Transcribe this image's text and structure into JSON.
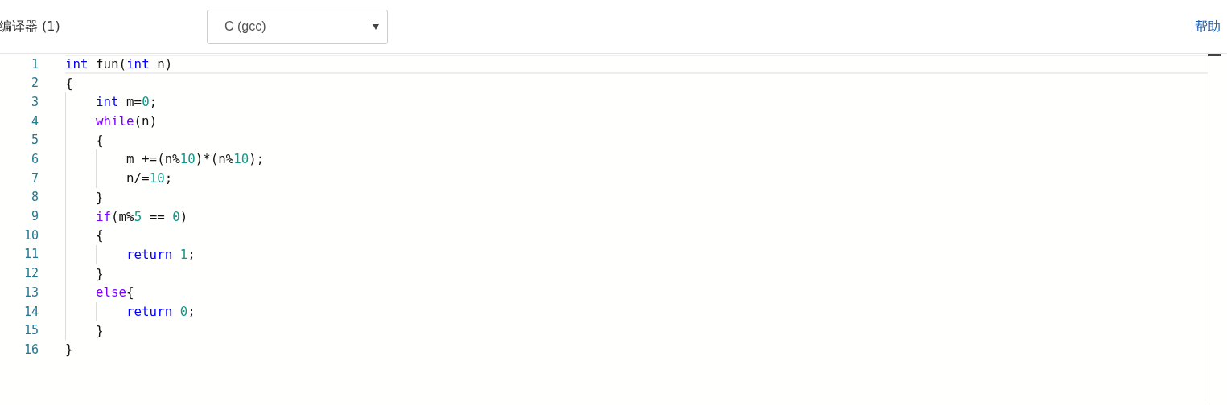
{
  "toolbar": {
    "compiler_label": "编译器 (1)",
    "language_select": {
      "value": "C (gcc)"
    },
    "help_link": "帮助"
  },
  "editor": {
    "lines": [
      {
        "number": "1",
        "current": true,
        "tokens": [
          {
            "kind": "keyword",
            "text": "int"
          },
          {
            "kind": "plain",
            "text": " fun("
          },
          {
            "kind": "keyword",
            "text": "int"
          },
          {
            "kind": "plain",
            "text": " n)"
          }
        ]
      },
      {
        "number": "2",
        "current": false,
        "tokens": [
          {
            "kind": "plain",
            "text": "{"
          }
        ]
      },
      {
        "number": "3",
        "current": false,
        "tokens": [
          {
            "kind": "keyword",
            "text": "    int"
          },
          {
            "kind": "plain",
            "text": " m="
          },
          {
            "kind": "number",
            "text": "0"
          },
          {
            "kind": "plain",
            "text": ";"
          }
        ]
      },
      {
        "number": "4",
        "current": false,
        "tokens": [
          {
            "kind": "control",
            "text": "    while"
          },
          {
            "kind": "plain",
            "text": "(n)"
          }
        ]
      },
      {
        "number": "5",
        "current": false,
        "tokens": [
          {
            "kind": "plain",
            "text": "    {"
          }
        ]
      },
      {
        "number": "6",
        "current": false,
        "tokens": [
          {
            "kind": "plain",
            "text": "        m +=(n%"
          },
          {
            "kind": "number",
            "text": "10"
          },
          {
            "kind": "plain",
            "text": ")*(n%"
          },
          {
            "kind": "number",
            "text": "10"
          },
          {
            "kind": "plain",
            "text": ");"
          }
        ]
      },
      {
        "number": "7",
        "current": false,
        "tokens": [
          {
            "kind": "plain",
            "text": "        n/="
          },
          {
            "kind": "number",
            "text": "10"
          },
          {
            "kind": "plain",
            "text": ";"
          }
        ]
      },
      {
        "number": "8",
        "current": false,
        "tokens": [
          {
            "kind": "plain",
            "text": "    }"
          }
        ]
      },
      {
        "number": "9",
        "current": false,
        "tokens": [
          {
            "kind": "control",
            "text": "    if"
          },
          {
            "kind": "plain",
            "text": "(m%"
          },
          {
            "kind": "number",
            "text": "5"
          },
          {
            "kind": "plain",
            "text": " == "
          },
          {
            "kind": "number",
            "text": "0"
          },
          {
            "kind": "plain",
            "text": ")"
          }
        ]
      },
      {
        "number": "10",
        "current": false,
        "tokens": [
          {
            "kind": "plain",
            "text": "    {"
          }
        ]
      },
      {
        "number": "11",
        "current": false,
        "tokens": [
          {
            "kind": "keyword",
            "text": "        return "
          },
          {
            "kind": "number",
            "text": "1"
          },
          {
            "kind": "plain",
            "text": ";"
          }
        ]
      },
      {
        "number": "12",
        "current": false,
        "tokens": [
          {
            "kind": "plain",
            "text": "    }"
          }
        ]
      },
      {
        "number": "13",
        "current": false,
        "tokens": [
          {
            "kind": "control",
            "text": "    else"
          },
          {
            "kind": "plain",
            "text": "{"
          }
        ]
      },
      {
        "number": "14",
        "current": false,
        "tokens": [
          {
            "kind": "keyword",
            "text": "        return "
          },
          {
            "kind": "number",
            "text": "0"
          },
          {
            "kind": "plain",
            "text": ";"
          }
        ]
      },
      {
        "number": "15",
        "current": false,
        "tokens": [
          {
            "kind": "plain",
            "text": "    }"
          }
        ]
      },
      {
        "number": "16",
        "current": false,
        "tokens": [
          {
            "kind": "plain",
            "text": "}"
          }
        ]
      }
    ]
  }
}
